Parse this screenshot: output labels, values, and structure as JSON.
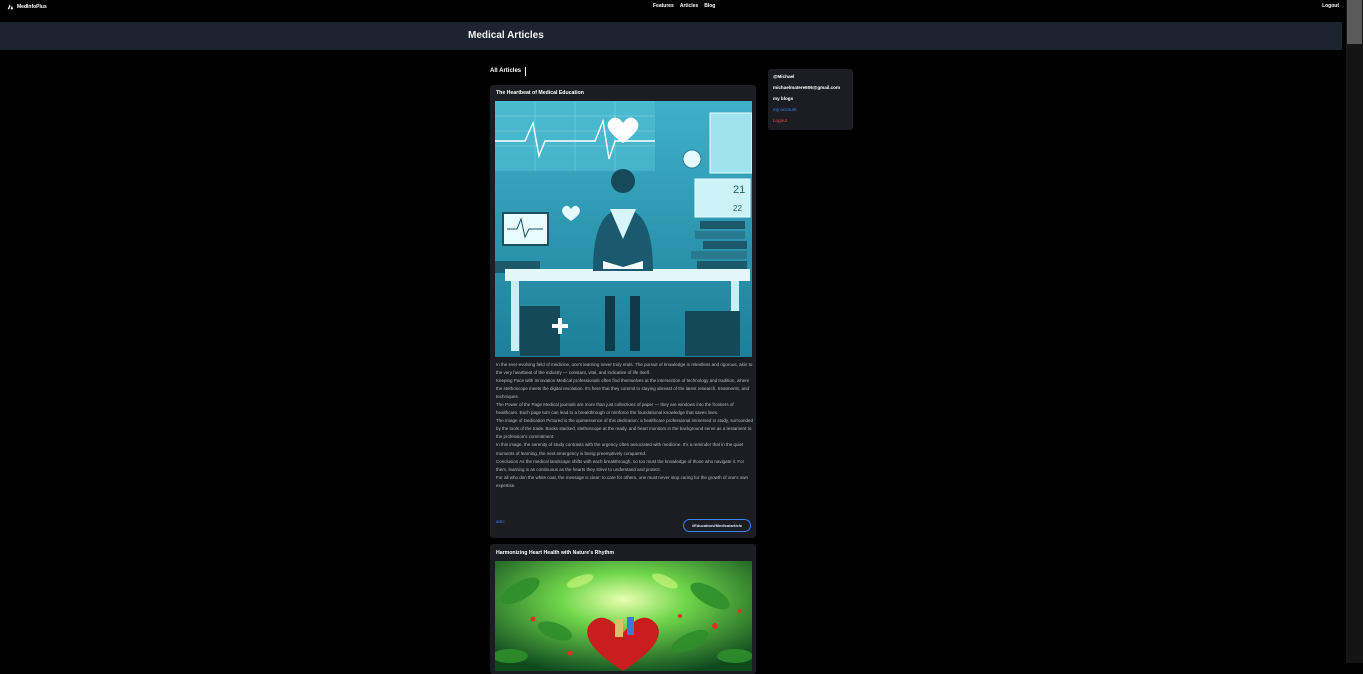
{
  "nav": {
    "brand": "MedInfoPlus",
    "links": [
      "Features",
      "Articles",
      "Blog"
    ],
    "logout": "Logout"
  },
  "header": {
    "title": "Medical Articles"
  },
  "section": {
    "title": "All Articles"
  },
  "articles": [
    {
      "title": "The Heartbeat of Medical Education",
      "paragraphs": [
        "In the ever-evolving field of medicine, one's learning never truly ends. The pursuit of knowledge is relentless and rigorous, akin to the very heartbeat of the industry — constant, vital, and indicative of life itself.",
        "Keeping Pace with Innovation Medical professionals often find themselves at the intersection of technology and tradition, where the stethoscope meets the digital revolution. It's here that they commit to staying abreast of the latest research, treatments, and techniques.",
        "The Power of the Page Medical journals are more than just collections of paper — they are windows into the frontiers of healthcare. Each page turn can lead to a breakthrough or reinforce the foundational knowledge that saves lives.",
        "The Image of Dedication Pictured is the quintessence of this dedication: a healthcare professional immersed in study, surrounded by the tools of the trade. Books stacked, stethoscope at the ready, and heart monitors in the background serve as a testament to the profession's commitment.",
        "In this image, the serenity of study contrasts with the urgency often associated with medicine. It's a reminder that in the quiet moments of learning, the next emergency is being preemptively conquered.",
        "Conclusion As the medical landscape shifts with each breakthrough, so too must the knowledge of those who navigate it. For them, learning is as continuous as the hearts they strive to understand and protect.",
        "For all who don the white coat, the message is clear: to care for others, one must never stop caring for the growth of one's own expertise."
      ],
      "author": "amc",
      "tag": "#Education#Medicalarticle",
      "image_text": [
        "21",
        "22"
      ]
    },
    {
      "title": "Harmonizing Heart Health with Nature's Rhythm"
    }
  ],
  "profile": {
    "handle": "@Michael",
    "email": "michaelmatere606@gmail.com",
    "blogs_label": "my blogs",
    "account_label": "my account",
    "logout_label": "Logout"
  },
  "colors": {
    "background": "#000000",
    "header_band": "#1c2430",
    "card": "#1b1d22",
    "link": "#3b82f6",
    "logout": "#ef4444"
  }
}
